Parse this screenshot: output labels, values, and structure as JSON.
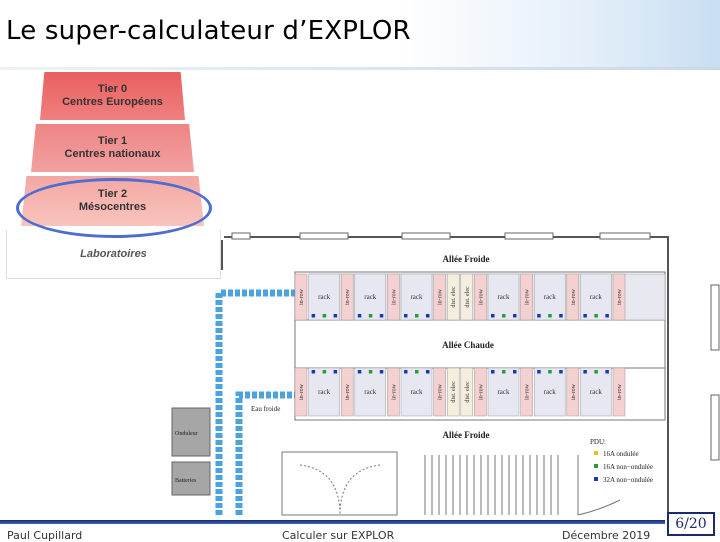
{
  "slide": {
    "title": "Le super-calculateur d’EXPLOR",
    "page_number": "6/20"
  },
  "pyramid": {
    "tier0": {
      "line1": "Tier 0",
      "line2": "Centres Européens"
    },
    "tier1": {
      "line1": "Tier 1",
      "line2": "Centres nationaux"
    },
    "tier2": {
      "line1": "Tier 2",
      "line2": "Mésocentres"
    },
    "tier3": {
      "line1": "Laboratoires"
    }
  },
  "floor_plan": {
    "cold_aisle_top": "Allée Froide",
    "hot_aisle": "Allée Chaude",
    "cold_aisle_bottom": "Allée Froide",
    "cold_water": "Eau froide",
    "ups": "Onduleur",
    "batteries": "Batteries",
    "rack": "rack",
    "in_row": "in-row",
    "dist_elec": "dist. elec",
    "pdu_legend": {
      "title": "PDU:",
      "items": [
        {
          "label": "16A ondulée",
          "color": "#e8c21a"
        },
        {
          "label": "16A non−ondulée",
          "color": "#2a9a3a"
        },
        {
          "label": "32A non−ondulée",
          "color": "#1a3ab0"
        }
      ]
    }
  },
  "footer": {
    "author": "Paul Cupillard",
    "subtitle": "Calculer sur EXPLOR",
    "date": "Décembre 2019"
  },
  "colors": {
    "accent": "#1b2a6a",
    "pipe_blue": "#4aa3e0",
    "highlight_ellipse": "#4f6dd1",
    "rack_pink": "#f5d0d0"
  }
}
